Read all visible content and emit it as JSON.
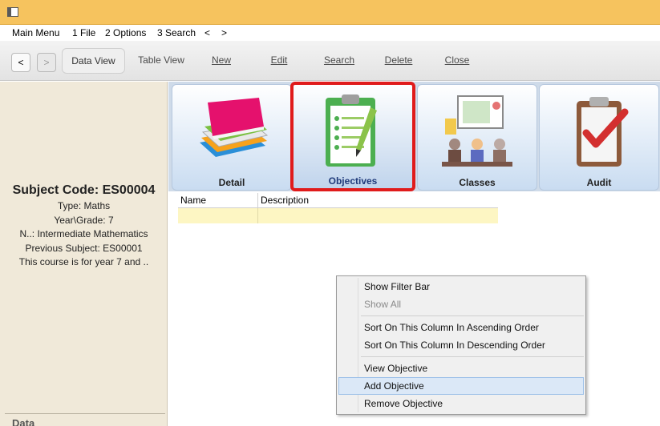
{
  "menubar": {
    "items": [
      "Main Menu",
      "1 File",
      "2 Options",
      "3 Search",
      "<",
      ">"
    ]
  },
  "toolbar": {
    "back": "<",
    "forward": ">",
    "data_view": "Data View",
    "table_view": "Table View",
    "new": "New",
    "edit": "Edit",
    "search": "Search",
    "delete": "Delete",
    "close": "Close"
  },
  "subject": {
    "code": "Subject Code: ES00004",
    "type": "Type: Maths",
    "year": "Year\\Grade: 7",
    "name": "N..: Intermediate Mathematics",
    "previous": "Previous Subject: ES00001",
    "description": "This course is for year 7 and .."
  },
  "left_footer": {
    "data_label": "Data"
  },
  "tiles": [
    {
      "label": "Detail",
      "icon": "books-icon"
    },
    {
      "label": "Objectives",
      "icon": "clipboard-pencil-icon",
      "selected": true
    },
    {
      "label": "Classes",
      "icon": "classroom-icon"
    },
    {
      "label": "Audit",
      "icon": "clipboard-check-icon"
    }
  ],
  "grid": {
    "columns": [
      "Name",
      "Description"
    ]
  },
  "context_menu": {
    "items": [
      {
        "label": "Show Filter Bar"
      },
      {
        "label": "Show All",
        "disabled": true
      },
      {
        "label": "Sort On This Column In Ascending Order"
      },
      {
        "label": "Sort On This Column In Descending Order"
      },
      {
        "label": "View Objective"
      },
      {
        "label": "Add Objective",
        "highlighted": true
      },
      {
        "label": "Remove Objective"
      }
    ]
  },
  "colors": {
    "titlebar": "#f6c35e",
    "left_panel": "#f0e9d9",
    "tile_bar": "#cfdbe9",
    "selection_border": "#e01b1b",
    "grid_row": "#fdf6c3",
    "menu_highlight": "#dbe8f7"
  }
}
